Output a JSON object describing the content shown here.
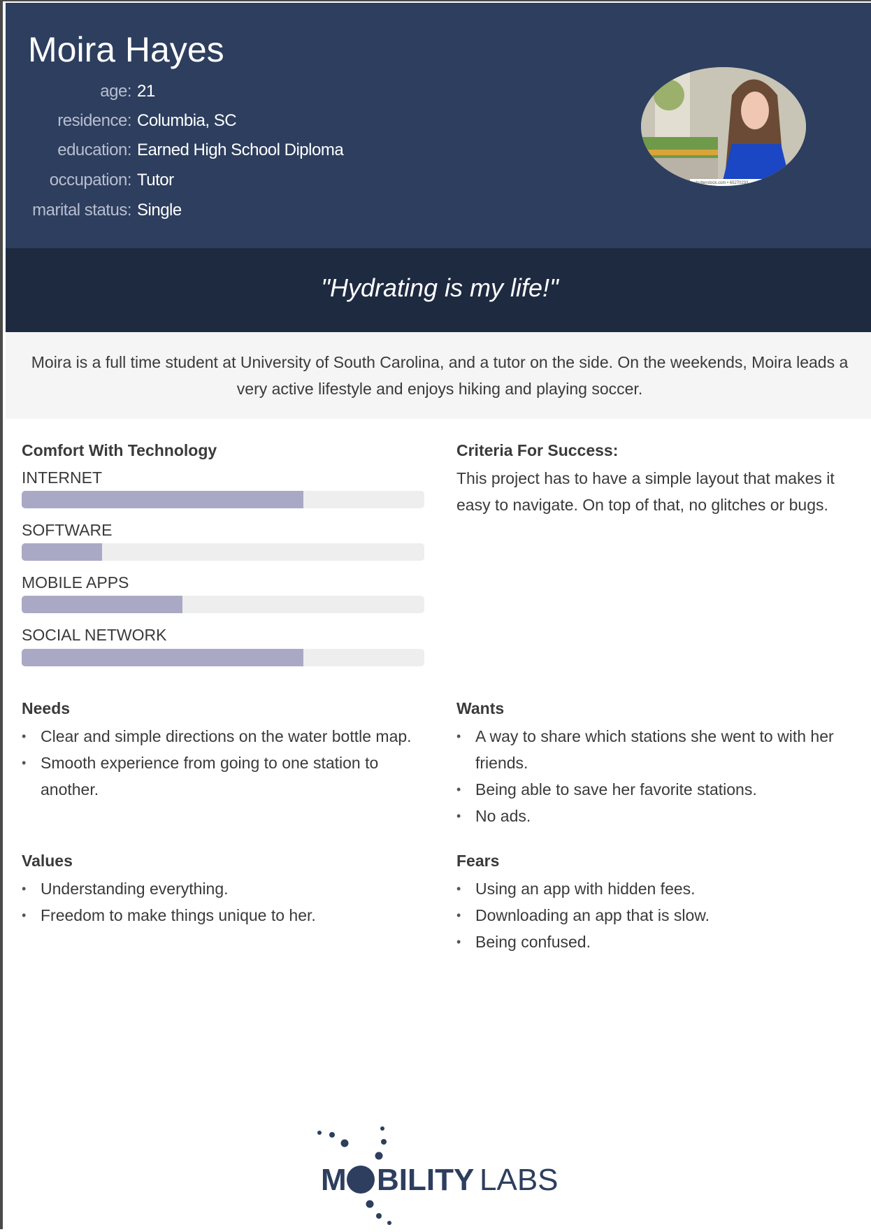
{
  "profile": {
    "name": "Moira Hayes",
    "fields": [
      {
        "label": "age:",
        "value": "21"
      },
      {
        "label": "residence:",
        "value": "Columbia, SC"
      },
      {
        "label": "education:",
        "value": "Earned High School Diploma"
      },
      {
        "label": "occupation:",
        "value": "Tutor"
      },
      {
        "label": "marital status:",
        "value": "Single"
      }
    ],
    "photo_watermark": "shutterstock.com • 65270233"
  },
  "quote": "\"Hydrating is my life!\"",
  "description": "Moira is a full time student at University of South Carolina, and a tutor on the side. On the weekends, Moira leads a very active lifestyle and enjoys hiking and playing soccer.",
  "comfort": {
    "title": "Comfort With Technology",
    "items": [
      {
        "label": "INTERNET",
        "level": 0.7
      },
      {
        "label": "SOFTWARE",
        "level": 0.2
      },
      {
        "label": "MOBILE APPS",
        "level": 0.4
      },
      {
        "label": "SOCIAL NETWORK",
        "level": 0.7
      }
    ]
  },
  "criteria": {
    "title": "Criteria For Success:",
    "text": "This project has to have a simple layout that makes it easy to navigate. On top of that, no glitches or bugs."
  },
  "needs": {
    "title": "Needs",
    "items": [
      "Clear and simple directions on the water bottle map.",
      "Smooth experience from going to one station to another."
    ]
  },
  "wants": {
    "title": "Wants",
    "items": [
      "A way to share which stations she went to with her friends.",
      "Being able to save her favorite stations.",
      "No ads."
    ]
  },
  "values": {
    "title": "Values",
    "items": [
      "Understanding everything.",
      "Freedom to make things unique to her."
    ]
  },
  "fears": {
    "title": "Fears",
    "items": [
      "Using an app with hidden fees.",
      "Downloading an app that is slow.",
      "Being confused."
    ]
  },
  "logo": {
    "text_bold": "M",
    "text_bold2": "BILITY",
    "text_light": "LABS",
    "color": "#2d3e5e"
  },
  "colors": {
    "header": "#2d3e5e",
    "quote_band": "#1e2a40",
    "bar_fill": "#aaa9c5",
    "bar_track": "#eeeeee"
  }
}
